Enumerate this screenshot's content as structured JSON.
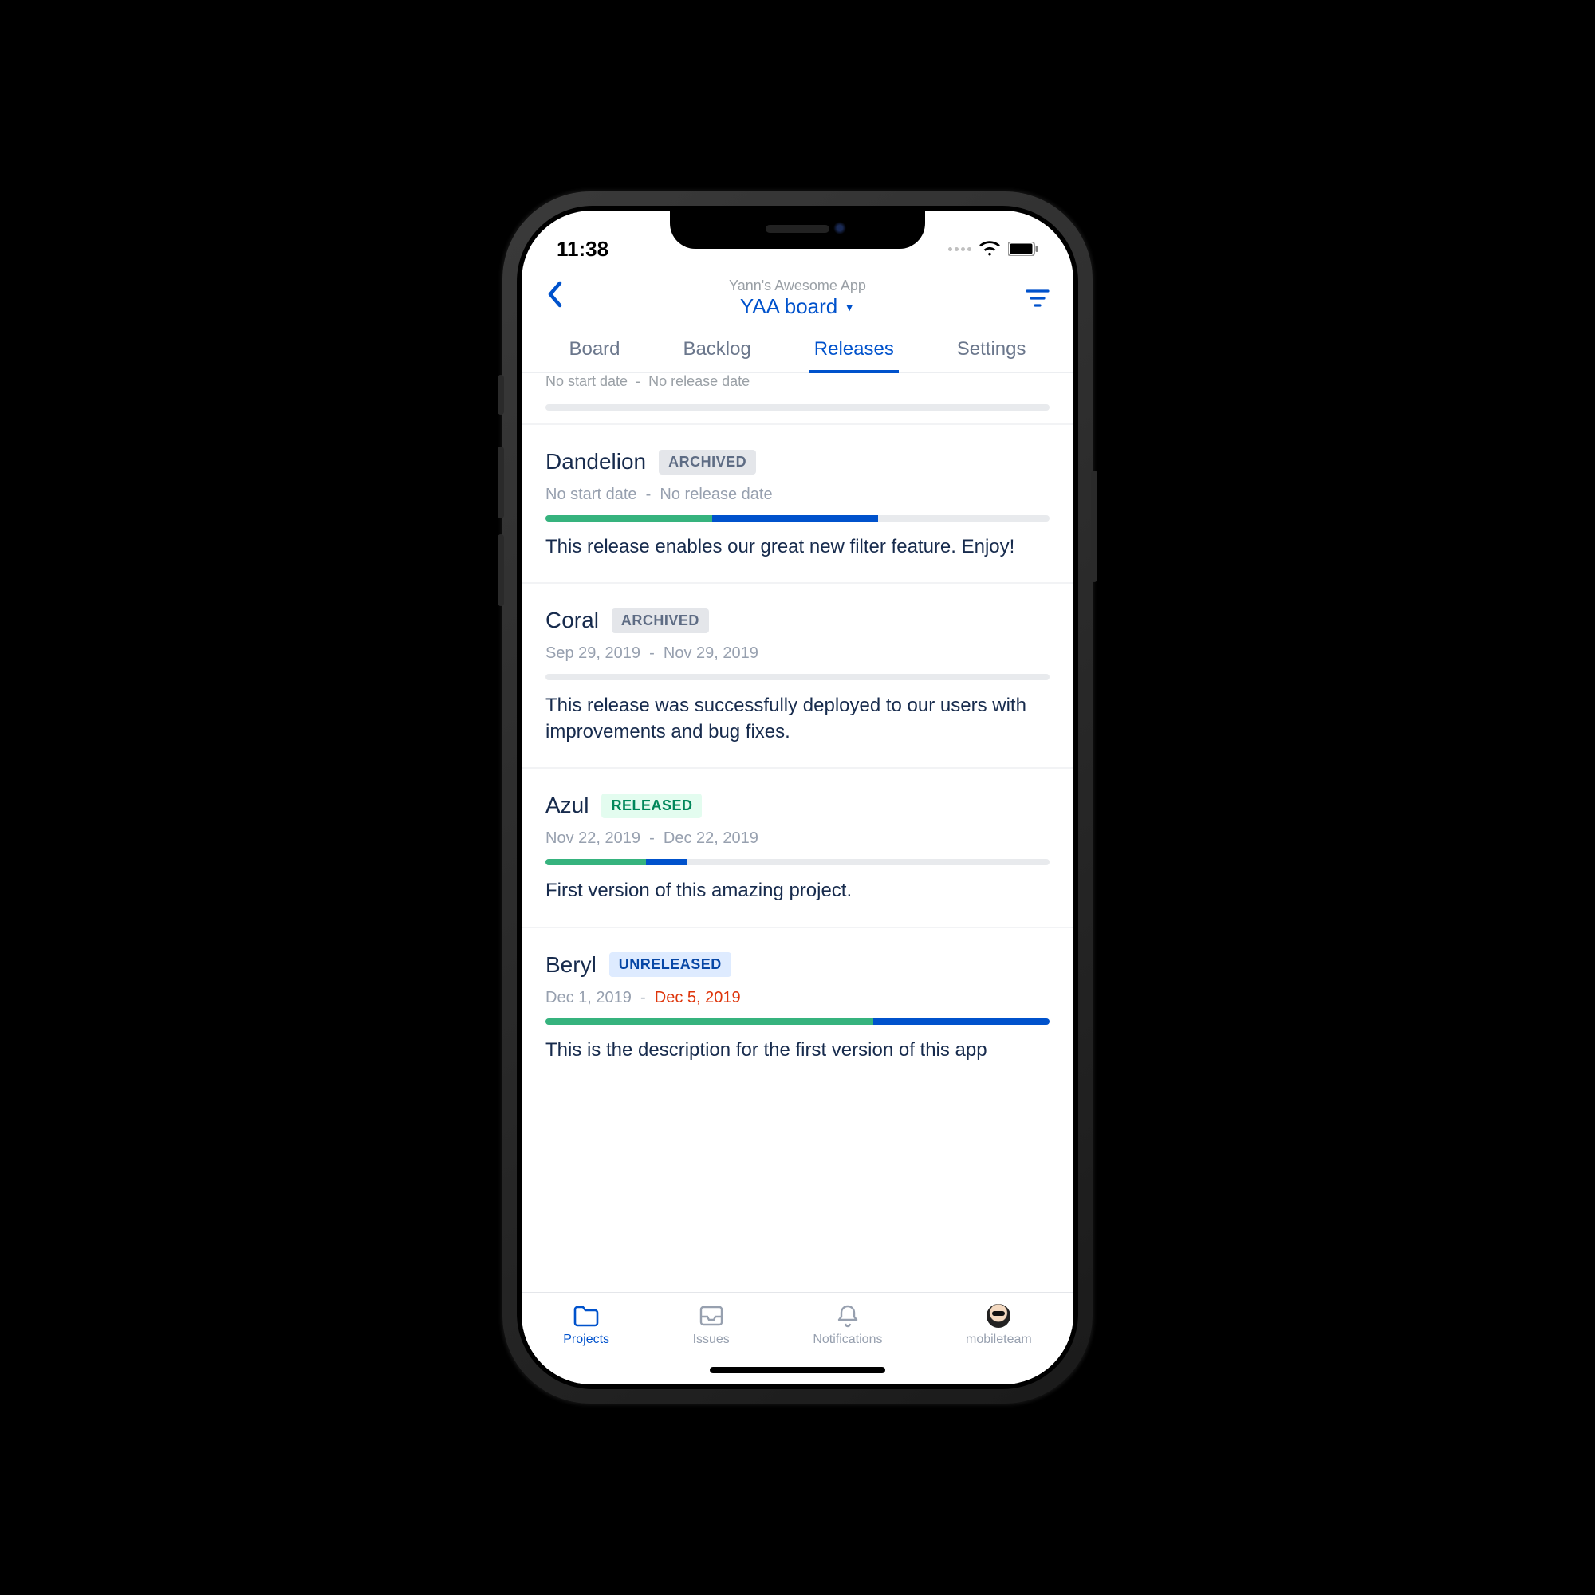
{
  "status": {
    "time": "11:38"
  },
  "header": {
    "subtitle": "Yann's Awesome App",
    "board_label": "YAA board"
  },
  "tabs": [
    {
      "label": "Board",
      "active": false
    },
    {
      "label": "Backlog",
      "active": false
    },
    {
      "label": "Releases",
      "active": true
    },
    {
      "label": "Settings",
      "active": false
    }
  ],
  "partial": {
    "start": "No start date",
    "sep": "-",
    "end": "No release date"
  },
  "releases": [
    {
      "name": "Dandelion",
      "status": "ARCHIVED",
      "status_kind": "archived",
      "start": "No start date",
      "end": "No release date",
      "end_overdue": false,
      "progress": {
        "green": 33,
        "blue": 33
      },
      "description": "This release enables our great new filter feature. Enjoy!"
    },
    {
      "name": "Coral",
      "status": "ARCHIVED",
      "status_kind": "archived",
      "start": "Sep 29, 2019",
      "end": "Nov 29, 2019",
      "end_overdue": false,
      "progress": {
        "green": 0,
        "blue": 0
      },
      "description": "This release was successfully deployed to our users with improvements and bug fixes."
    },
    {
      "name": "Azul",
      "status": "RELEASED",
      "status_kind": "released",
      "start": "Nov 22, 2019",
      "end": "Dec 22, 2019",
      "end_overdue": false,
      "progress": {
        "green": 20,
        "blue": 8
      },
      "description": "First version of this amazing project."
    },
    {
      "name": "Beryl",
      "status": "UNRELEASED",
      "status_kind": "unreleased",
      "start": "Dec 1, 2019",
      "end": "Dec 5, 2019",
      "end_overdue": true,
      "progress": {
        "green": 65,
        "blue": 35
      },
      "description": "This is the description for the first version of this app"
    }
  ],
  "tabbar": [
    {
      "label": "Projects",
      "icon": "folder",
      "active": true
    },
    {
      "label": "Issues",
      "icon": "tray",
      "active": false
    },
    {
      "label": "Notifications",
      "icon": "bell",
      "active": false
    },
    {
      "label": "mobileteam",
      "icon": "avatar",
      "active": false
    }
  ],
  "date_sep": "-"
}
